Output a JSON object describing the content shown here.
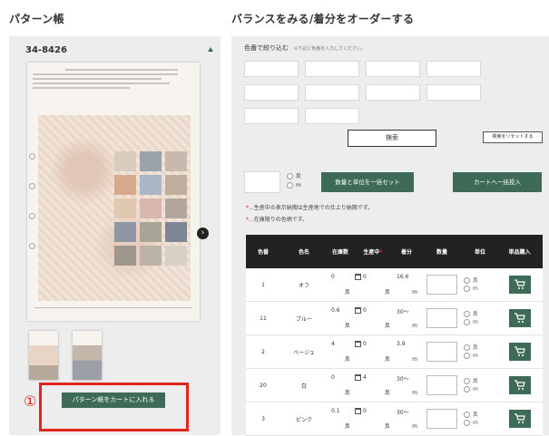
{
  "left": {
    "heading": "パターン帳",
    "sample_code": "34-8426",
    "add_pattern_button": "パターン帳をカートに入れる",
    "annotation_marker": "①"
  },
  "right": {
    "heading": "バランスをみる/着分をオーダーする",
    "filter_label": "色番で絞り込む",
    "filter_note": "※下記に色番を入力してください。",
    "search_button": "検索",
    "reset_button": "検索をリセットする",
    "unit_options": [
      "反",
      "m"
    ],
    "bulk_set_button": "数量と単位を一括セット",
    "bulk_cart_button": "カートへ一括投入",
    "note1": "...生産中の表示納期は生産地での仕上り納期です。",
    "note2": "...在庫限りの色柄です。",
    "note_marker": "*"
  },
  "table": {
    "headers": [
      "色番",
      "色名",
      "在庫数",
      "生産中",
      "着分",
      "数量",
      "単位",
      "単品購入"
    ],
    "header_marker": "*",
    "rows": [
      {
        "no": "1",
        "name": "オフ",
        "stock": "0",
        "stock_unit": "反",
        "prod": "0",
        "prod_unit": "反",
        "chakubun": "16.6",
        "chakubun_unit": "m"
      },
      {
        "no": "11",
        "name": "ブルー",
        "stock": "0.6",
        "stock_unit": "反",
        "prod": "0",
        "prod_unit": "反",
        "chakubun": "30〜",
        "chakubun_unit": "m"
      },
      {
        "no": "2",
        "name": "ベージュ",
        "stock": "4",
        "stock_unit": "反",
        "prod": "0",
        "prod_unit": "反",
        "chakubun": "3.9",
        "chakubun_unit": "m"
      },
      {
        "no": "20",
        "name": "白",
        "stock": "0",
        "stock_unit": "反",
        "prod": "4",
        "prod_unit": "反",
        "chakubun": "30〜",
        "chakubun_unit": "m"
      },
      {
        "no": "3",
        "name": "ピンク",
        "stock": "0.1",
        "stock_unit": "反",
        "prod": "0",
        "prod_unit": "反",
        "chakubun": "30〜",
        "chakubun_unit": "m"
      }
    ]
  },
  "colors": {
    "brand_green": "#3d6b57",
    "accent_red": "#e0261d",
    "header_black": "#222222"
  }
}
